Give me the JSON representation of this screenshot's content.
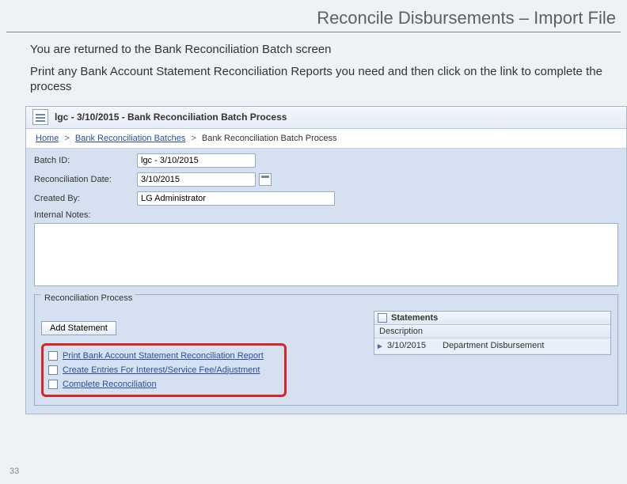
{
  "slide": {
    "title": "Reconcile Disbursements – Import File",
    "page_number": "33"
  },
  "instructions": {
    "line1": "You are returned to the Bank Reconciliation Batch screen",
    "line2": "Print any Bank Account Statement Reconciliation Reports you need and then click on the link to complete the process"
  },
  "window": {
    "title": "lgc - 3/10/2015 - Bank Reconciliation Batch Process"
  },
  "breadcrumb": {
    "home": "Home",
    "batches": "Bank Reconciliation Batches",
    "current": "Bank Reconciliation Batch Process",
    "sep": ">"
  },
  "form": {
    "batch_id_label": "Batch ID:",
    "batch_id_value": "lgc - 3/10/2015",
    "recon_date_label": "Reconciliation Date:",
    "recon_date_value": "3/10/2015",
    "created_by_label": "Created By:",
    "created_by_value": "LG Administrator",
    "notes_label": "Internal Notes:"
  },
  "process": {
    "legend": "Reconciliation Process",
    "add_button": "Add Statement",
    "links": {
      "print": "Print Bank Account Statement Reconciliation Report",
      "entries": "Create Entries For Interest/Service Fee/Adjustment",
      "complete": "Complete Reconciliation"
    }
  },
  "statements": {
    "title": "Statements",
    "col_header": "Description",
    "rows": [
      {
        "date": "3/10/2015",
        "desc": "Department Disbursement"
      }
    ]
  }
}
